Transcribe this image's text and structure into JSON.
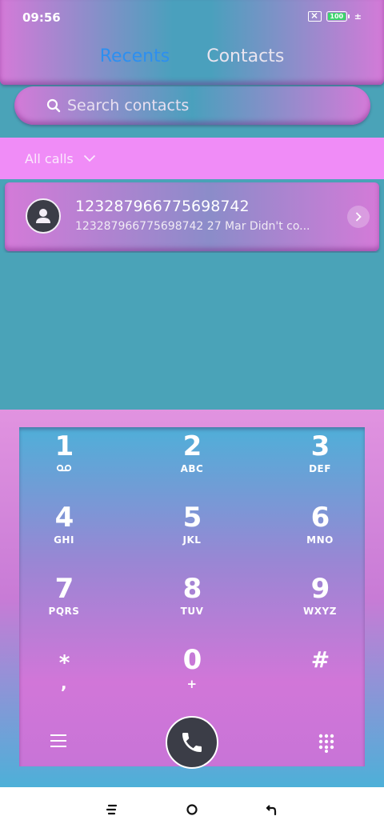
{
  "status": {
    "time": "09:56",
    "battery": "100",
    "charge_symbol": "±"
  },
  "tabs": [
    {
      "label": "Recents",
      "active": true
    },
    {
      "label": "Contacts",
      "active": false
    }
  ],
  "search": {
    "placeholder": "Search contacts"
  },
  "filter": {
    "label": "All calls"
  },
  "recents": [
    {
      "name": "123287966775698742",
      "subtitle": "123287966775698742  27 Mar Didn't co..."
    }
  ],
  "dialpad": {
    "keys": [
      {
        "digit": "1",
        "letters": ""
      },
      {
        "digit": "2",
        "letters": "ABC"
      },
      {
        "digit": "3",
        "letters": "DEF"
      },
      {
        "digit": "4",
        "letters": "GHI"
      },
      {
        "digit": "5",
        "letters": "JKL"
      },
      {
        "digit": "6",
        "letters": "MNO"
      },
      {
        "digit": "7",
        "letters": "PQRS"
      },
      {
        "digit": "8",
        "letters": "TUV"
      },
      {
        "digit": "9",
        "letters": "WXYZ"
      },
      {
        "digit": "*",
        "letters": ","
      },
      {
        "digit": "0",
        "letters": "+"
      },
      {
        "digit": "#",
        "letters": ""
      }
    ]
  },
  "colors": {
    "accent": "#2d8ff0",
    "pink": "#d47ad8",
    "teal": "#4aa3b8",
    "filter_band": "#f08cf7",
    "battery_green": "#3dd46b",
    "call_button": "#3b3d47"
  },
  "icons": {
    "search": "search-icon",
    "avatar": "person-icon",
    "arrow": "chevron-right-icon",
    "voicemail": "voicemail-icon",
    "menu": "menu-icon",
    "call": "phone-icon",
    "dialpad": "dialpad-icon"
  }
}
